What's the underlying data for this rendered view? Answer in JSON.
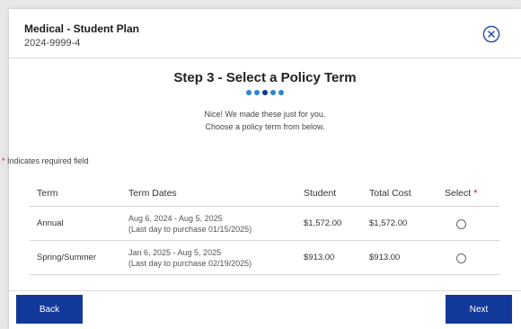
{
  "header": {
    "title": "Medical - Student Plan",
    "plan_id": "2024-9999-4"
  },
  "step": {
    "title": "Step 3 - Select a Policy Term",
    "progress": {
      "total_steps": 5,
      "current_step": 3
    },
    "message_line1": "Nice! We made these just for you.",
    "message_line2": "Choose a policy term from below."
  },
  "required_note": {
    "asterisk": "*",
    "text": "Indicates required field"
  },
  "table": {
    "columns": {
      "term": "Term",
      "dates": "Term Dates",
      "student": "Student",
      "total": "Total Cost",
      "select": "Select",
      "select_required": "*"
    },
    "rows": [
      {
        "term": "Annual",
        "dates": "Aug 6, 2024 - Aug 5, 2025",
        "purchase_by": "(Last day to purchase 01/15/2025)",
        "student": "$1,572.00",
        "total": "$1,572.00",
        "selected": false
      },
      {
        "term": "Spring/Summer",
        "dates": "Jan 6, 2025 - Aug 5, 2025",
        "purchase_by": "(Last day to purchase 02/19/2025)",
        "student": "$913.00",
        "total": "$913.00",
        "selected": false
      }
    ]
  },
  "footer": {
    "back_label": "Back",
    "next_label": "Next"
  },
  "colors": {
    "primary": "#12399a",
    "dot": "#2a86d1",
    "required": "#d0021b"
  }
}
